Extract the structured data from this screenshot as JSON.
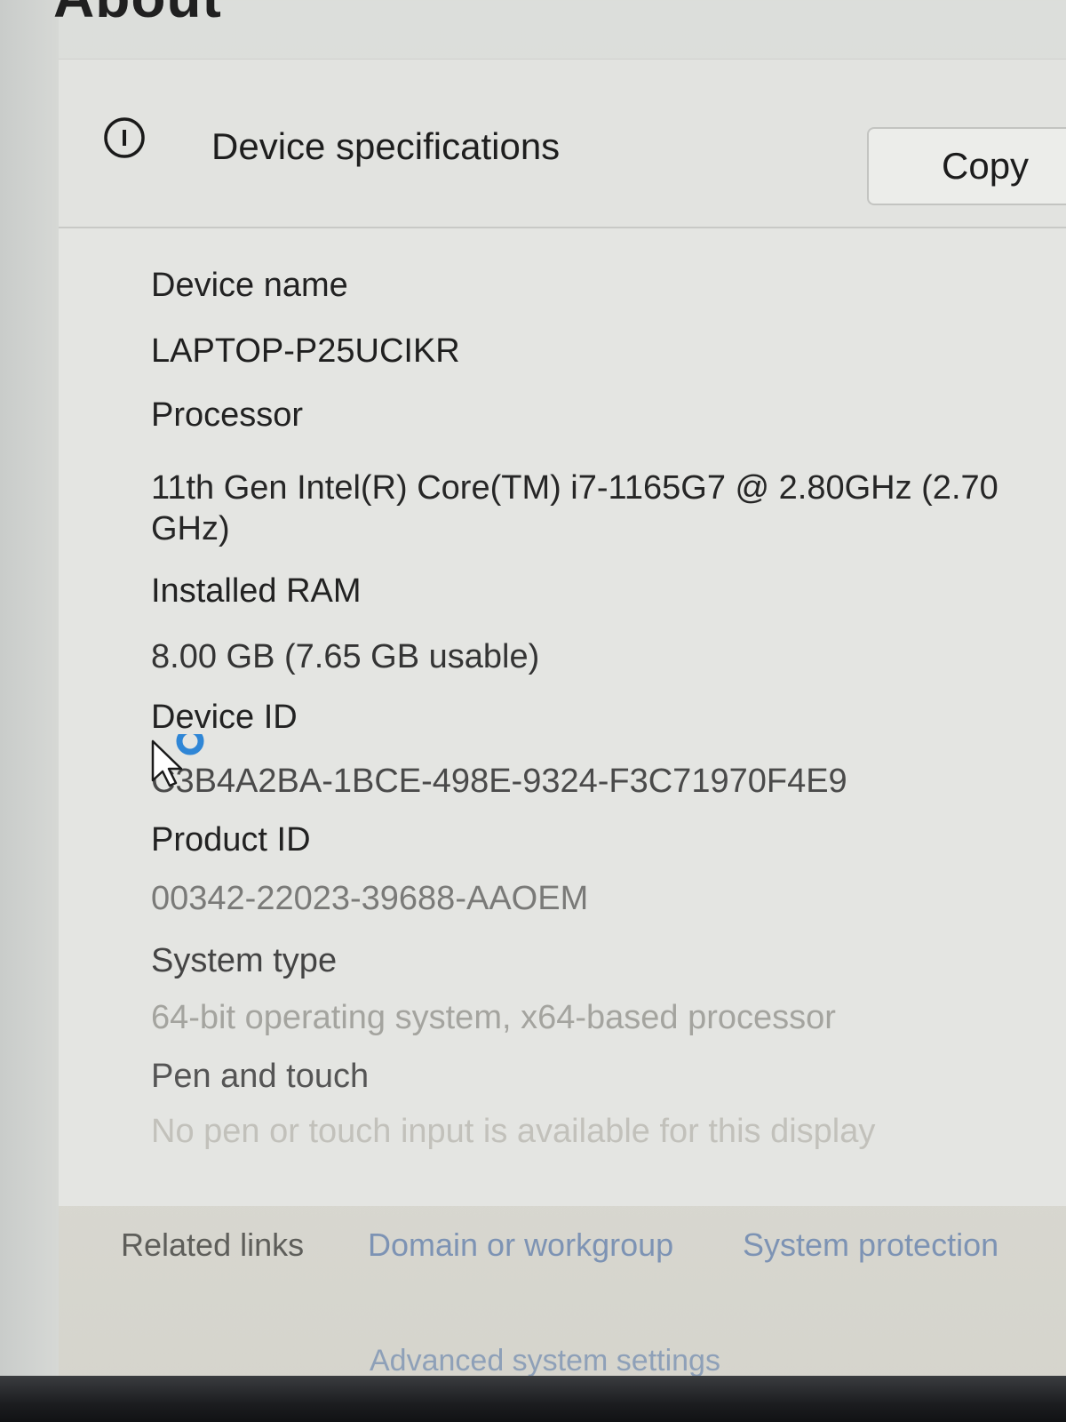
{
  "header": {
    "title": "About"
  },
  "card": {
    "title": "Device specifications",
    "icon": "info-icon",
    "copy_label": "Copy"
  },
  "specs": [
    {
      "label": "Device name",
      "value": "LAPTOP-P25UCIKR"
    },
    {
      "label": "Processor",
      "value": "11th Gen Intel(R) Core(TM) i7-1165G7 @ 2.80GHz (2.70 GHz)"
    },
    {
      "label": "Installed RAM",
      "value": "8.00 GB (7.65 GB usable)"
    },
    {
      "label": "Device ID",
      "value": "C3B4A2BA-1BCE-498E-9324-F3C71970F4E9"
    },
    {
      "label": "Product ID",
      "value": "00342-22023-39688-AAOEM"
    },
    {
      "label": "System type",
      "value": "64-bit operating system, x64-based processor"
    },
    {
      "label": "Pen and touch",
      "value": "No pen or touch input is available for this display"
    }
  ],
  "related": {
    "label": "Related links",
    "links": [
      "Domain or workgroup",
      "System protection",
      "Advanced system settings"
    ]
  },
  "colors": {
    "link": "#7d93b4",
    "busy_cursor_ring": "#2f86d6"
  }
}
